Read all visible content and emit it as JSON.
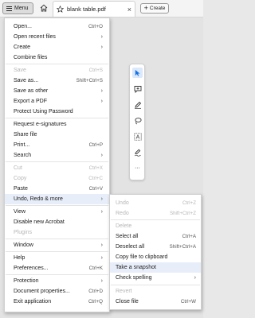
{
  "toolbar": {
    "menu_label": "Menu",
    "tab_title": "blank table.pdf",
    "tab_close": "×",
    "create_label": "Create",
    "create_plus": "+"
  },
  "main_menu": {
    "items": [
      {
        "label": "Open...",
        "shortcut": "Ctrl+O",
        "disabled": false
      },
      {
        "label": "Open recent files",
        "shortcut": "",
        "disabled": false,
        "submenu": true
      },
      {
        "label": "Create",
        "shortcut": "",
        "disabled": false,
        "submenu": true
      },
      {
        "label": "Combine files",
        "shortcut": "",
        "disabled": false
      },
      {
        "label": "Save",
        "shortcut": "Ctrl+S",
        "disabled": true
      },
      {
        "label": "Save as...",
        "shortcut": "Shift+Ctrl+S",
        "disabled": false
      },
      {
        "label": "Save as other",
        "shortcut": "",
        "disabled": false,
        "submenu": true
      },
      {
        "label": "Export a PDF",
        "shortcut": "",
        "disabled": false,
        "submenu": true
      },
      {
        "label": "Protect Using Password",
        "shortcut": "",
        "disabled": false
      },
      {
        "label": "Request e-signatures",
        "shortcut": "",
        "disabled": false
      },
      {
        "label": "Share file",
        "shortcut": "",
        "disabled": false
      },
      {
        "label": "Print...",
        "shortcut": "Ctrl+P",
        "disabled": false
      },
      {
        "label": "Search",
        "shortcut": "",
        "disabled": false,
        "submenu": true
      },
      {
        "label": "Cut",
        "shortcut": "Ctrl+X",
        "disabled": true
      },
      {
        "label": "Copy",
        "shortcut": "Ctrl+C",
        "disabled": true
      },
      {
        "label": "Paste",
        "shortcut": "Ctrl+V",
        "disabled": false
      },
      {
        "label": "Undo, Redo & more",
        "shortcut": "",
        "disabled": false,
        "submenu": true,
        "highlight": true
      },
      {
        "label": "View",
        "shortcut": "",
        "disabled": false,
        "submenu": true
      },
      {
        "label": "Disable new Acrobat",
        "shortcut": "",
        "disabled": false
      },
      {
        "label": "Plugins",
        "shortcut": "",
        "disabled": true
      },
      {
        "label": "Window",
        "shortcut": "",
        "disabled": false,
        "submenu": true
      },
      {
        "label": "Help",
        "shortcut": "",
        "disabled": false,
        "submenu": true
      },
      {
        "label": "Preferences...",
        "shortcut": "Ctrl+K",
        "disabled": false
      },
      {
        "label": "Protection",
        "shortcut": "",
        "disabled": false,
        "submenu": true
      },
      {
        "label": "Document properties...",
        "shortcut": "Ctrl+D",
        "disabled": false
      },
      {
        "label": "Exit application",
        "shortcut": "Ctrl+Q",
        "disabled": false
      }
    ]
  },
  "sub_menu": {
    "items": [
      {
        "label": "Undo",
        "shortcut": "Ctrl+Z",
        "disabled": true
      },
      {
        "label": "Redo",
        "shortcut": "Shift+Ctrl+Z",
        "disabled": true
      },
      {
        "label": "Delete",
        "shortcut": "",
        "disabled": true
      },
      {
        "label": "Select all",
        "shortcut": "Ctrl+A",
        "disabled": false
      },
      {
        "label": "Deselect all",
        "shortcut": "Shift+Ctrl+A",
        "disabled": false
      },
      {
        "label": "Copy file to clipboard",
        "shortcut": "",
        "disabled": false
      },
      {
        "label": "Take a snapshot",
        "shortcut": "",
        "disabled": false,
        "highlight": true
      },
      {
        "label": "Check spelling",
        "shortcut": "",
        "disabled": false,
        "submenu": true
      },
      {
        "label": "Revert",
        "shortcut": "",
        "disabled": true
      },
      {
        "label": "Close file",
        "shortcut": "Ctrl+W",
        "disabled": false
      }
    ]
  },
  "toolstrip": {
    "tools": [
      "select-cursor-icon",
      "add-comment-icon",
      "draw-pen-icon",
      "lasso-icon",
      "add-text-icon",
      "fill-sign-icon",
      "more-tools-icon"
    ],
    "selected": "select-cursor-icon",
    "more_glyph": "···",
    "text_glyph": "A",
    "close_glyph": "×"
  },
  "colors": {
    "accent": "#1473e6",
    "highlight_bg": "#e8eef9",
    "disabled_text": "#b6b6b6"
  }
}
